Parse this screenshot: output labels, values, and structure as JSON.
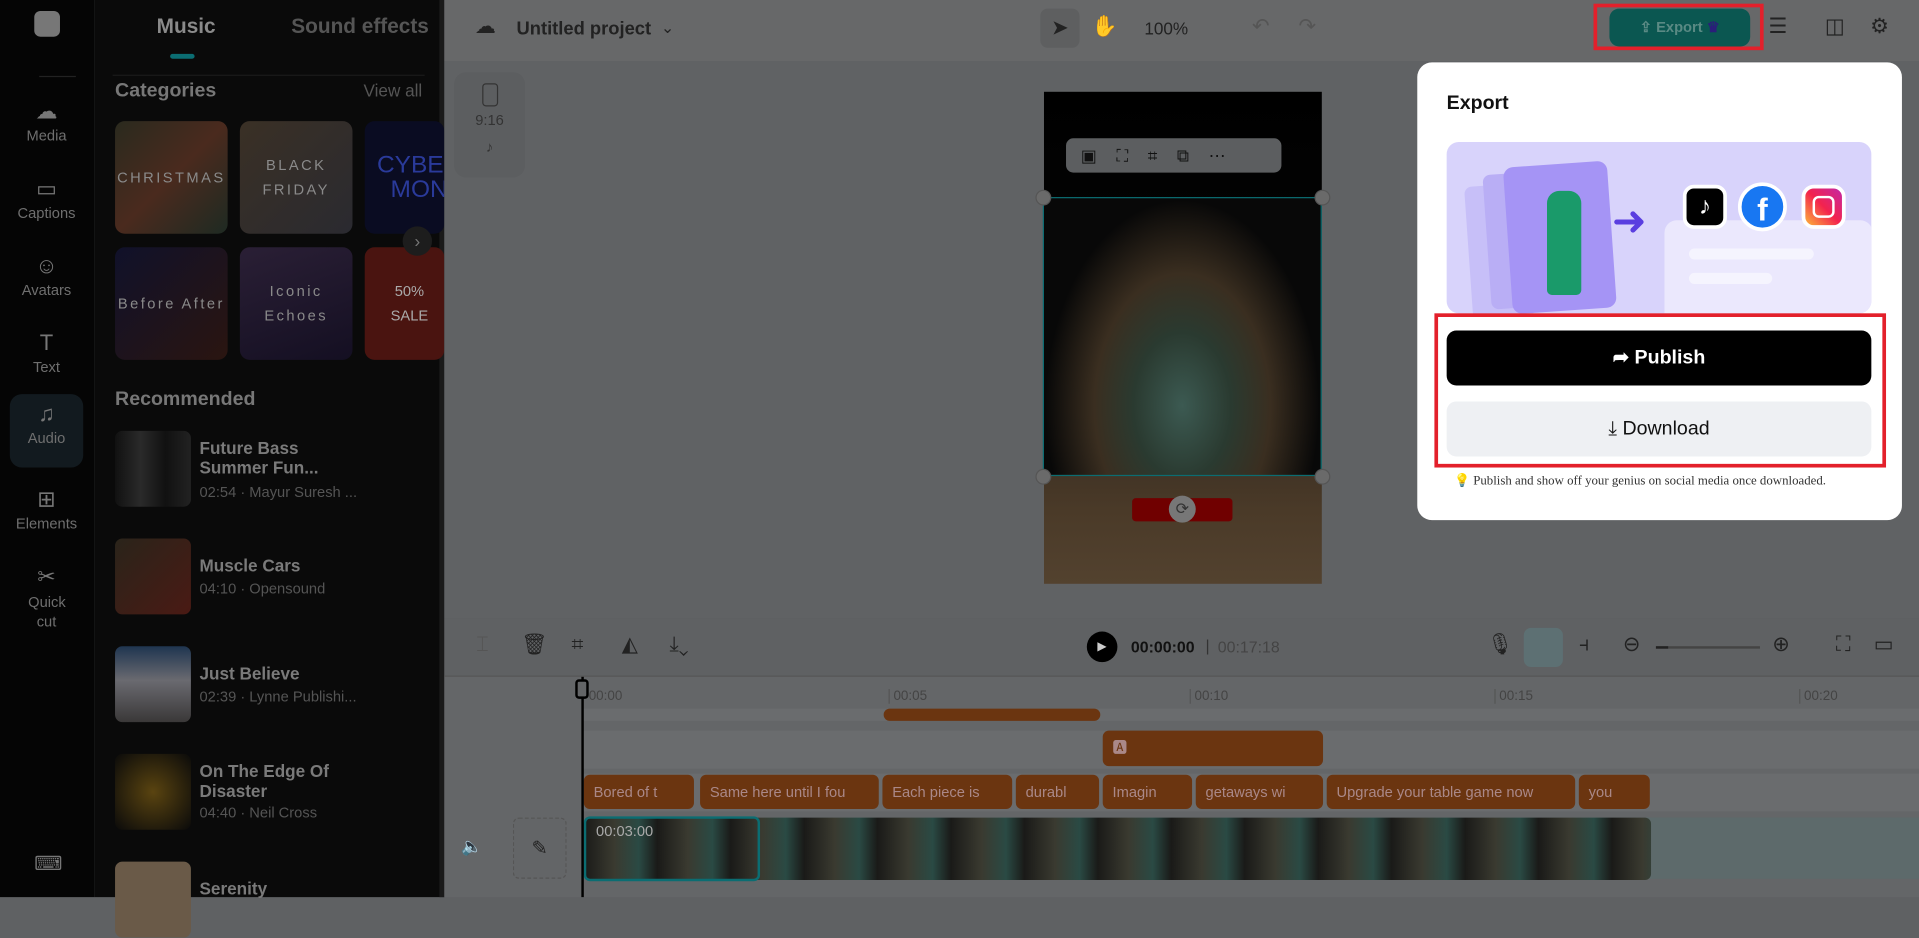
{
  "nav": {
    "items": [
      {
        "label": "Media",
        "icon": "cloud-upload-icon"
      },
      {
        "label": "Captions",
        "icon": "captions-icon"
      },
      {
        "label": "Avatars",
        "icon": "avatar-icon"
      },
      {
        "label": "Text",
        "icon": "text-icon"
      },
      {
        "label": "Audio",
        "icon": "music-note-icon",
        "active": true
      },
      {
        "label": "Elements",
        "icon": "elements-icon"
      },
      {
        "label": "Quick cut",
        "icon": "scissors-icon"
      }
    ]
  },
  "panel": {
    "tabs": [
      "Music",
      "Sound effects"
    ],
    "categories_title": "Categories",
    "view_all": "View all",
    "categories": [
      "CHRISTMAS",
      "BLACK FRIDAY",
      "CYBER MON",
      "Before After",
      "Iconic Echoes",
      "50% SALE"
    ],
    "recommended_title": "Recommended",
    "tracks": [
      {
        "title": "Future Bass Summer Fun...",
        "meta": "02:54 · Mayur Suresh ..."
      },
      {
        "title": "Muscle Cars",
        "meta": "04:10 · Opensound"
      },
      {
        "title": "Just Believe",
        "meta": "02:39 · Lynne Publishi..."
      },
      {
        "title": "On The Edge Of Disaster",
        "meta": "04:40 · Neil Cross"
      },
      {
        "title": "Serenity",
        "meta": ""
      }
    ]
  },
  "topbar": {
    "project_title": "Untitled project",
    "zoom": "100%",
    "export_label": "Export"
  },
  "canvas": {
    "ratio": "9:16"
  },
  "timeline": {
    "current_time": "00:00:00",
    "total_time": "00:17:18",
    "ruler": [
      "00:00",
      "00:05",
      "00:10",
      "00:15",
      "00:20"
    ],
    "captions": [
      "Bored of t",
      "Same here until I fou",
      "Each piece is",
      "durabl",
      "Imagin",
      "getaways wi",
      "Upgrade your table game now",
      "you"
    ],
    "clip_duration": "00:03:00"
  },
  "export_dialog": {
    "title": "Export",
    "publish": "Publish",
    "download": "Download",
    "tip": "Publish and show off your genius on social media once downloaded.",
    "brand_colors": {
      "facebook": "#1877f2",
      "tiktok": "#000000"
    }
  }
}
